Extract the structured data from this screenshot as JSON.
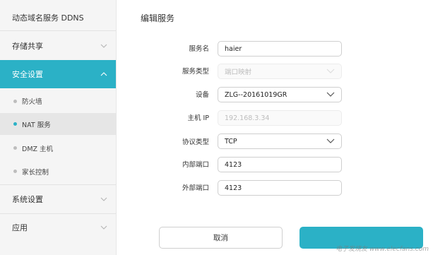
{
  "sidebar": {
    "items": [
      {
        "label": "动态域名服务 DDNS"
      },
      {
        "label": "存储共享"
      },
      {
        "label": "安全设置"
      },
      {
        "label": "防火墙"
      },
      {
        "label": "NAT 服务"
      },
      {
        "label": "DMZ 主机"
      },
      {
        "label": "家长控制"
      },
      {
        "label": "系统设置"
      },
      {
        "label": "应用"
      }
    ]
  },
  "page": {
    "title": "编辑服务"
  },
  "form": {
    "service_name": {
      "label": "服务名",
      "value": "haier"
    },
    "service_type": {
      "label": "服务类型",
      "value": "端口映射"
    },
    "device": {
      "label": "设备",
      "value": "ZLG--20161019GR"
    },
    "host_ip": {
      "label": "主机 IP",
      "value": "192.168.3.34"
    },
    "protocol": {
      "label": "协议类型",
      "value": "TCP"
    },
    "internal_port": {
      "label": "内部端口",
      "value": "4123"
    },
    "external_port": {
      "label": "外部端口",
      "value": "4123"
    }
  },
  "buttons": {
    "cancel": "取消"
  },
  "watermark": "电子发烧友 www.elecfans.com",
  "colors": {
    "accent": "#2bb1c6"
  }
}
